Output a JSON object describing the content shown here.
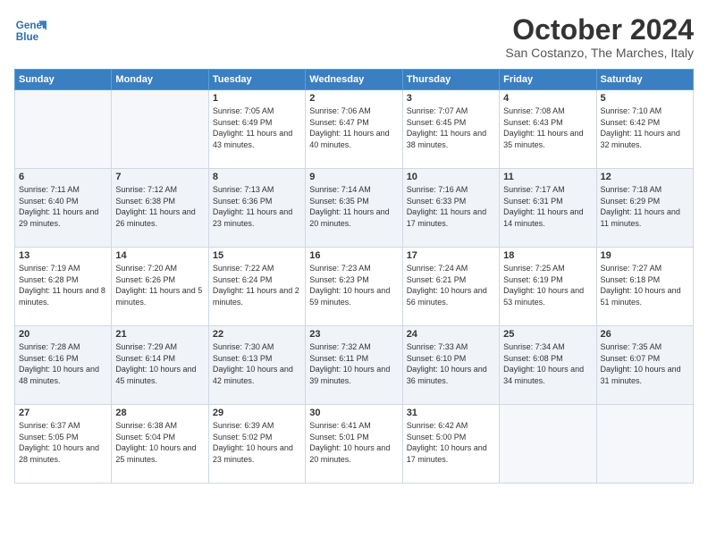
{
  "logo": {
    "line1": "General",
    "line2": "Blue"
  },
  "title": "October 2024",
  "subtitle": "San Costanzo, The Marches, Italy",
  "headers": [
    "Sunday",
    "Monday",
    "Tuesday",
    "Wednesday",
    "Thursday",
    "Friday",
    "Saturday"
  ],
  "weeks": [
    [
      {
        "day": "",
        "sunrise": "",
        "sunset": "",
        "daylight": "",
        "shaded": false
      },
      {
        "day": "",
        "sunrise": "",
        "sunset": "",
        "daylight": "",
        "shaded": false
      },
      {
        "day": "1",
        "sunrise": "Sunrise: 7:05 AM",
        "sunset": "Sunset: 6:49 PM",
        "daylight": "Daylight: 11 hours and 43 minutes.",
        "shaded": false
      },
      {
        "day": "2",
        "sunrise": "Sunrise: 7:06 AM",
        "sunset": "Sunset: 6:47 PM",
        "daylight": "Daylight: 11 hours and 40 minutes.",
        "shaded": false
      },
      {
        "day": "3",
        "sunrise": "Sunrise: 7:07 AM",
        "sunset": "Sunset: 6:45 PM",
        "daylight": "Daylight: 11 hours and 38 minutes.",
        "shaded": false
      },
      {
        "day": "4",
        "sunrise": "Sunrise: 7:08 AM",
        "sunset": "Sunset: 6:43 PM",
        "daylight": "Daylight: 11 hours and 35 minutes.",
        "shaded": false
      },
      {
        "day": "5",
        "sunrise": "Sunrise: 7:10 AM",
        "sunset": "Sunset: 6:42 PM",
        "daylight": "Daylight: 11 hours and 32 minutes.",
        "shaded": false
      }
    ],
    [
      {
        "day": "6",
        "sunrise": "Sunrise: 7:11 AM",
        "sunset": "Sunset: 6:40 PM",
        "daylight": "Daylight: 11 hours and 29 minutes.",
        "shaded": true
      },
      {
        "day": "7",
        "sunrise": "Sunrise: 7:12 AM",
        "sunset": "Sunset: 6:38 PM",
        "daylight": "Daylight: 11 hours and 26 minutes.",
        "shaded": true
      },
      {
        "day": "8",
        "sunrise": "Sunrise: 7:13 AM",
        "sunset": "Sunset: 6:36 PM",
        "daylight": "Daylight: 11 hours and 23 minutes.",
        "shaded": true
      },
      {
        "day": "9",
        "sunrise": "Sunrise: 7:14 AM",
        "sunset": "Sunset: 6:35 PM",
        "daylight": "Daylight: 11 hours and 20 minutes.",
        "shaded": true
      },
      {
        "day": "10",
        "sunrise": "Sunrise: 7:16 AM",
        "sunset": "Sunset: 6:33 PM",
        "daylight": "Daylight: 11 hours and 17 minutes.",
        "shaded": true
      },
      {
        "day": "11",
        "sunrise": "Sunrise: 7:17 AM",
        "sunset": "Sunset: 6:31 PM",
        "daylight": "Daylight: 11 hours and 14 minutes.",
        "shaded": true
      },
      {
        "day": "12",
        "sunrise": "Sunrise: 7:18 AM",
        "sunset": "Sunset: 6:29 PM",
        "daylight": "Daylight: 11 hours and 11 minutes.",
        "shaded": true
      }
    ],
    [
      {
        "day": "13",
        "sunrise": "Sunrise: 7:19 AM",
        "sunset": "Sunset: 6:28 PM",
        "daylight": "Daylight: 11 hours and 8 minutes.",
        "shaded": false
      },
      {
        "day": "14",
        "sunrise": "Sunrise: 7:20 AM",
        "sunset": "Sunset: 6:26 PM",
        "daylight": "Daylight: 11 hours and 5 minutes.",
        "shaded": false
      },
      {
        "day": "15",
        "sunrise": "Sunrise: 7:22 AM",
        "sunset": "Sunset: 6:24 PM",
        "daylight": "Daylight: 11 hours and 2 minutes.",
        "shaded": false
      },
      {
        "day": "16",
        "sunrise": "Sunrise: 7:23 AM",
        "sunset": "Sunset: 6:23 PM",
        "daylight": "Daylight: 10 hours and 59 minutes.",
        "shaded": false
      },
      {
        "day": "17",
        "sunrise": "Sunrise: 7:24 AM",
        "sunset": "Sunset: 6:21 PM",
        "daylight": "Daylight: 10 hours and 56 minutes.",
        "shaded": false
      },
      {
        "day": "18",
        "sunrise": "Sunrise: 7:25 AM",
        "sunset": "Sunset: 6:19 PM",
        "daylight": "Daylight: 10 hours and 53 minutes.",
        "shaded": false
      },
      {
        "day": "19",
        "sunrise": "Sunrise: 7:27 AM",
        "sunset": "Sunset: 6:18 PM",
        "daylight": "Daylight: 10 hours and 51 minutes.",
        "shaded": false
      }
    ],
    [
      {
        "day": "20",
        "sunrise": "Sunrise: 7:28 AM",
        "sunset": "Sunset: 6:16 PM",
        "daylight": "Daylight: 10 hours and 48 minutes.",
        "shaded": true
      },
      {
        "day": "21",
        "sunrise": "Sunrise: 7:29 AM",
        "sunset": "Sunset: 6:14 PM",
        "daylight": "Daylight: 10 hours and 45 minutes.",
        "shaded": true
      },
      {
        "day": "22",
        "sunrise": "Sunrise: 7:30 AM",
        "sunset": "Sunset: 6:13 PM",
        "daylight": "Daylight: 10 hours and 42 minutes.",
        "shaded": true
      },
      {
        "day": "23",
        "sunrise": "Sunrise: 7:32 AM",
        "sunset": "Sunset: 6:11 PM",
        "daylight": "Daylight: 10 hours and 39 minutes.",
        "shaded": true
      },
      {
        "day": "24",
        "sunrise": "Sunrise: 7:33 AM",
        "sunset": "Sunset: 6:10 PM",
        "daylight": "Daylight: 10 hours and 36 minutes.",
        "shaded": true
      },
      {
        "day": "25",
        "sunrise": "Sunrise: 7:34 AM",
        "sunset": "Sunset: 6:08 PM",
        "daylight": "Daylight: 10 hours and 34 minutes.",
        "shaded": true
      },
      {
        "day": "26",
        "sunrise": "Sunrise: 7:35 AM",
        "sunset": "Sunset: 6:07 PM",
        "daylight": "Daylight: 10 hours and 31 minutes.",
        "shaded": true
      }
    ],
    [
      {
        "day": "27",
        "sunrise": "Sunrise: 6:37 AM",
        "sunset": "Sunset: 5:05 PM",
        "daylight": "Daylight: 10 hours and 28 minutes.",
        "shaded": false
      },
      {
        "day": "28",
        "sunrise": "Sunrise: 6:38 AM",
        "sunset": "Sunset: 5:04 PM",
        "daylight": "Daylight: 10 hours and 25 minutes.",
        "shaded": false
      },
      {
        "day": "29",
        "sunrise": "Sunrise: 6:39 AM",
        "sunset": "Sunset: 5:02 PM",
        "daylight": "Daylight: 10 hours and 23 minutes.",
        "shaded": false
      },
      {
        "day": "30",
        "sunrise": "Sunrise: 6:41 AM",
        "sunset": "Sunset: 5:01 PM",
        "daylight": "Daylight: 10 hours and 20 minutes.",
        "shaded": false
      },
      {
        "day": "31",
        "sunrise": "Sunrise: 6:42 AM",
        "sunset": "Sunset: 5:00 PM",
        "daylight": "Daylight: 10 hours and 17 minutes.",
        "shaded": false
      },
      {
        "day": "",
        "sunrise": "",
        "sunset": "",
        "daylight": "",
        "shaded": false
      },
      {
        "day": "",
        "sunrise": "",
        "sunset": "",
        "daylight": "",
        "shaded": false
      }
    ]
  ]
}
